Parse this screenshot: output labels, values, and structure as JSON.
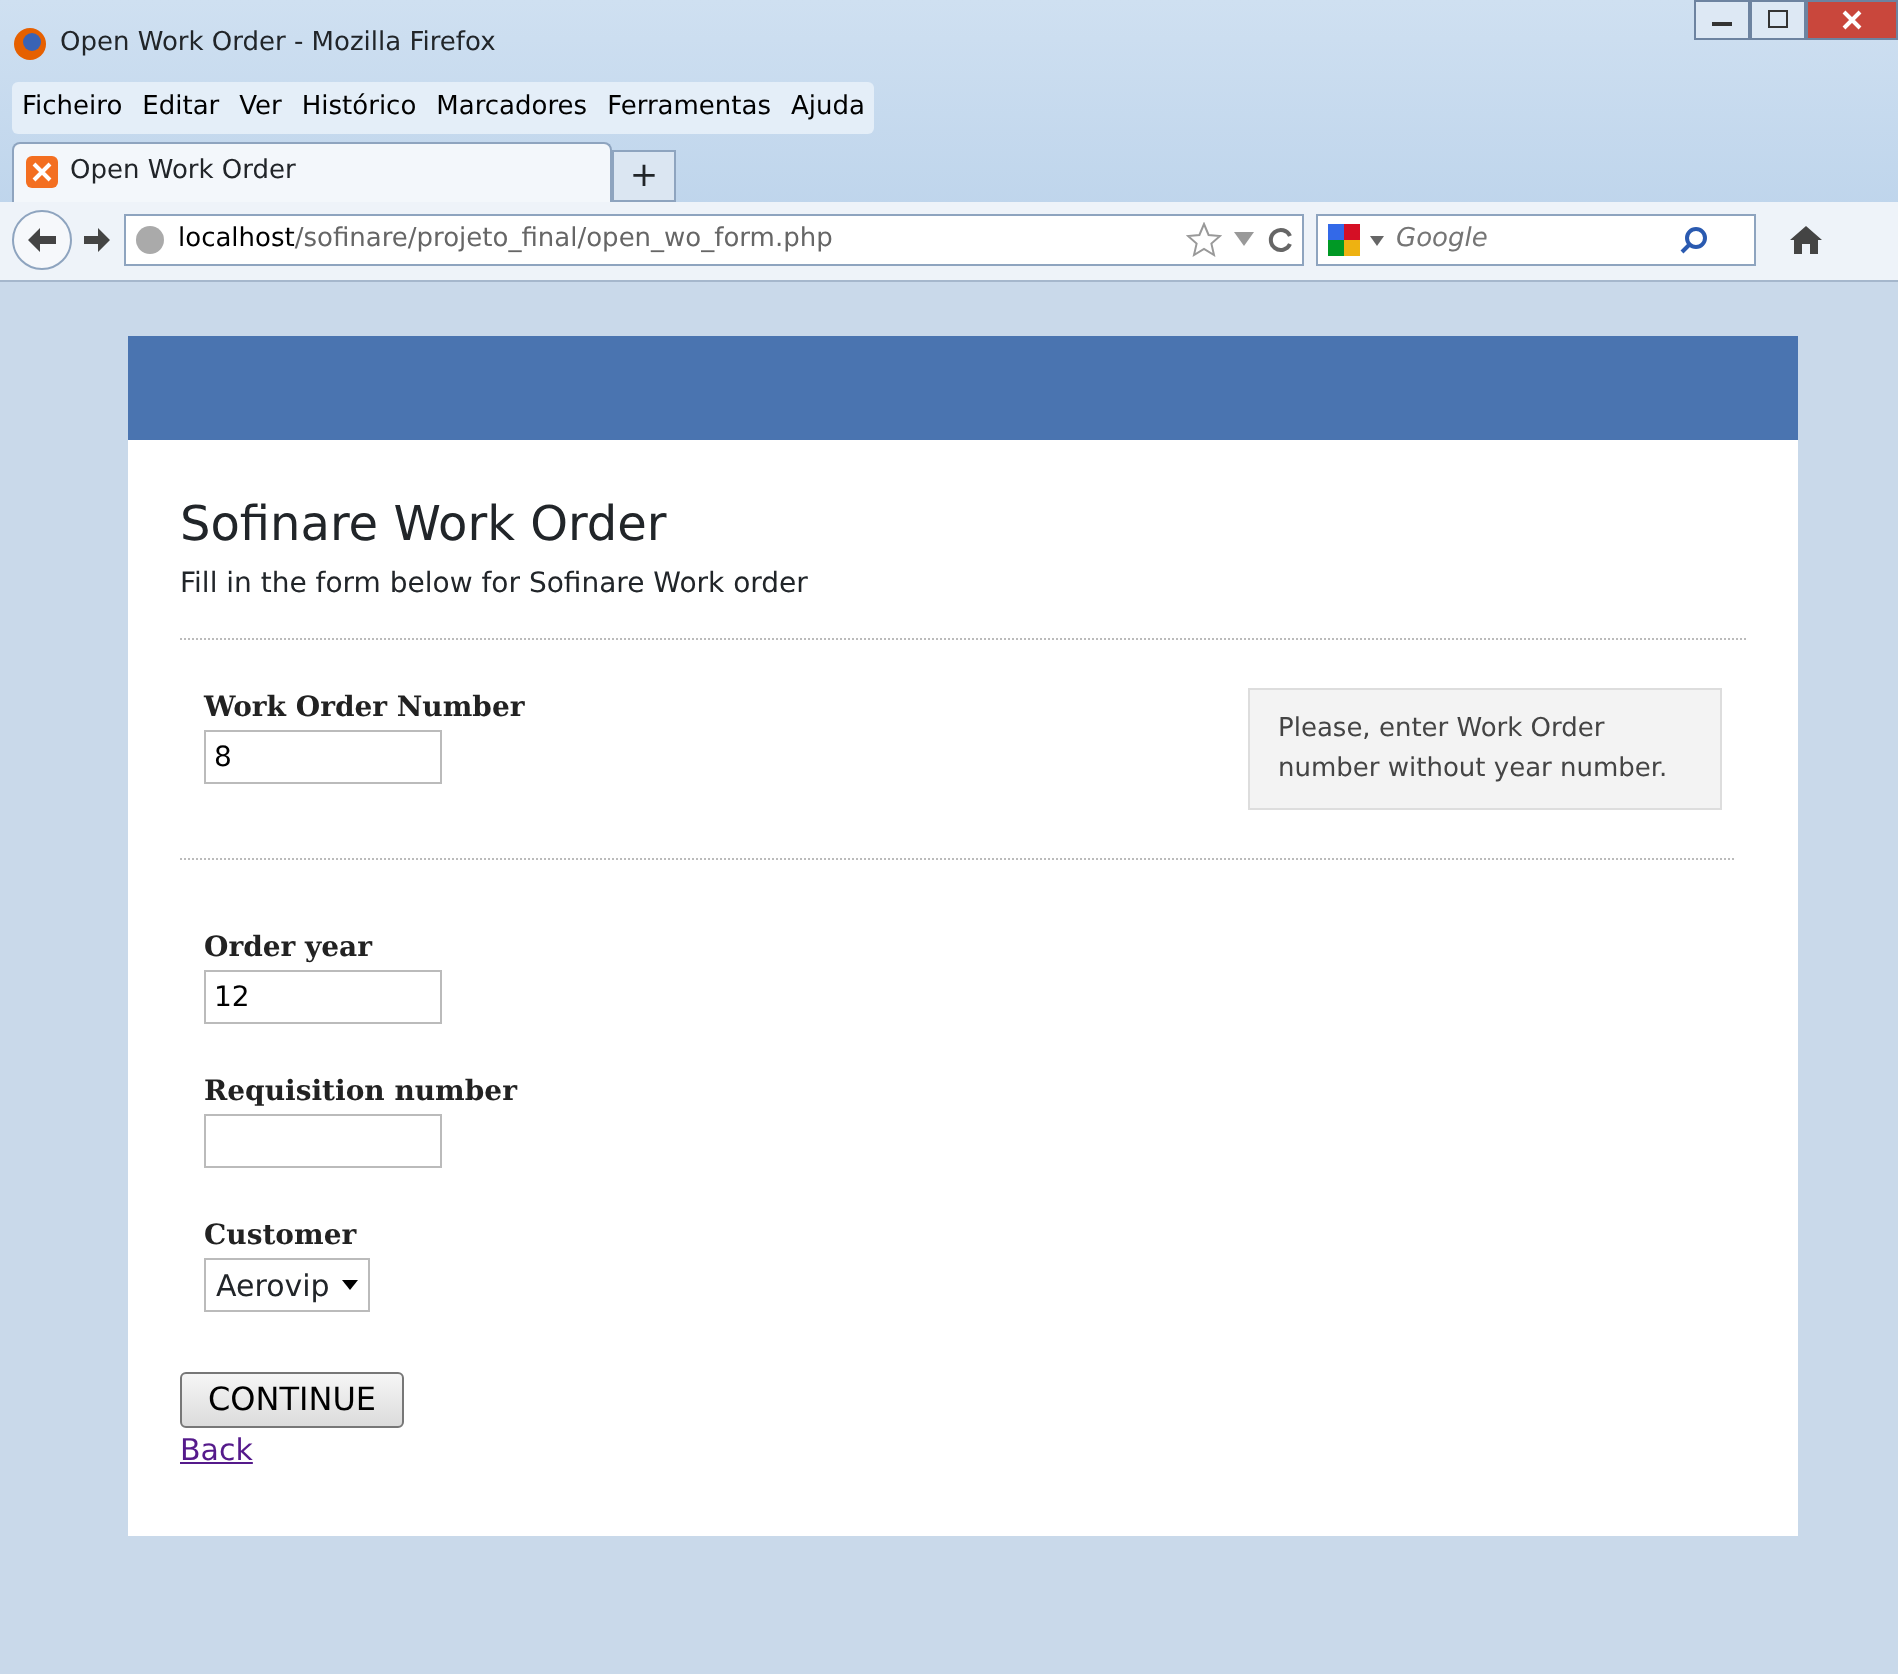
{
  "window": {
    "title": "Open Work Order - Mozilla Firefox"
  },
  "menu": [
    "Ficheiro",
    "Editar",
    "Ver",
    "Histórico",
    "Marcadores",
    "Ferramentas",
    "Ajuda"
  ],
  "tabs": [
    {
      "label": "Open Work Order",
      "selected": true
    }
  ],
  "new_tab": "+",
  "address": {
    "host": "localhost",
    "path": "/sofinare/projeto_final/open_wo_form.php"
  },
  "search": {
    "placeholder": "Google"
  },
  "page": {
    "title": "Sofinare Work Order",
    "subtitle": "Fill in the form below for Sofinare Work order",
    "fields": [
      {
        "kind": "text",
        "label": "Work Order Number",
        "value": "8",
        "hint": "Please, enter Work Order number without year number."
      },
      {
        "kind": "text",
        "label": "Order year",
        "value": "12"
      },
      {
        "kind": "text",
        "label": "Requisition number"
      },
      {
        "kind": "select",
        "label": "Customer",
        "value": "Aerovip"
      }
    ],
    "button": "CONTINUE",
    "link": "Back"
  }
}
